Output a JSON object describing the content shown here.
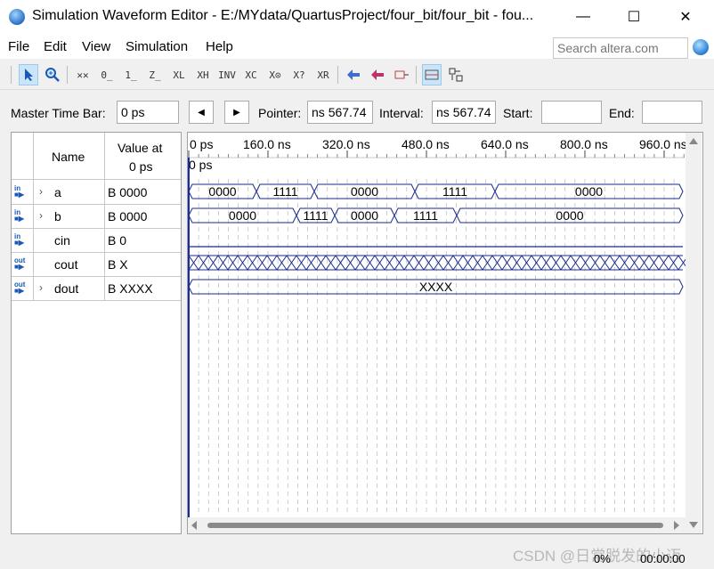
{
  "window": {
    "title": "Simulation Waveform Editor - E:/MYdata/QuartusProject/four_bit/four_bit - fou...",
    "minimize": "—",
    "maximize": "☐",
    "close": "✕"
  },
  "menu": [
    "File",
    "Edit",
    "View",
    "Simulation",
    "Help"
  ],
  "search": {
    "placeholder": "Search altera.com"
  },
  "toolbar": {
    "tools": [
      "pointer-tool",
      "zoom-tool",
      "unknown-x",
      "forcing-low-0",
      "forcing-high-1",
      "high-impedance-z",
      "weak-low-l",
      "weak-high-h",
      "invert-inv",
      "count-value-c",
      "overwrite-clock",
      "random-value-r",
      "arbitrary-value-q",
      "snap-to-grid",
      "run-functional",
      "run-timing",
      "run-timing-netlist",
      "edit-grid",
      "waveform-compare"
    ]
  },
  "timebar": {
    "master_label": "Master Time Bar:",
    "master_value": "0 ps",
    "pointer_label": "Pointer:",
    "pointer_value": "567.74 ns",
    "interval_label": "Interval:",
    "interval_value": "567.74 ns",
    "start_label": "Start:",
    "start_value": "",
    "end_label": "End:",
    "end_value": ""
  },
  "columns": {
    "name": "Name",
    "value_line1": "Value at",
    "value_line2": "0 ps"
  },
  "signals": [
    {
      "name": "a",
      "value": "B 0000",
      "dir": "in",
      "expandable": true
    },
    {
      "name": "b",
      "value": "B 0000",
      "dir": "in",
      "expandable": true
    },
    {
      "name": "cin",
      "value": "B 0",
      "dir": "in",
      "expandable": false
    },
    {
      "name": "cout",
      "value": "B X",
      "dir": "out",
      "expandable": false
    },
    {
      "name": "dout",
      "value": "B XXXX",
      "dir": "out",
      "expandable": true
    }
  ],
  "ruler": {
    "ticks": [
      "0 ps",
      "160.0 ns",
      "320.0 ns",
      "480.0 ns",
      "640.0 ns",
      "800.0 ns",
      "960.0 ns"
    ],
    "cursor_label": "0 ps"
  },
  "waves": {
    "a": [
      "0000",
      "1111",
      "0000",
      "1111",
      "0000"
    ],
    "b": [
      "0000",
      "1111",
      "0000",
      "1111",
      "0000"
    ],
    "dout": [
      "XXXX"
    ]
  },
  "status": {
    "progress": "0%",
    "time": "00:00:00"
  },
  "watermark": "CSDN @日常脱发的小迈",
  "colors": {
    "wave": "#1a2a8c",
    "cursor": "#1a2aa8",
    "grid": "#bbbbbb",
    "pin": "#1a58b5"
  }
}
